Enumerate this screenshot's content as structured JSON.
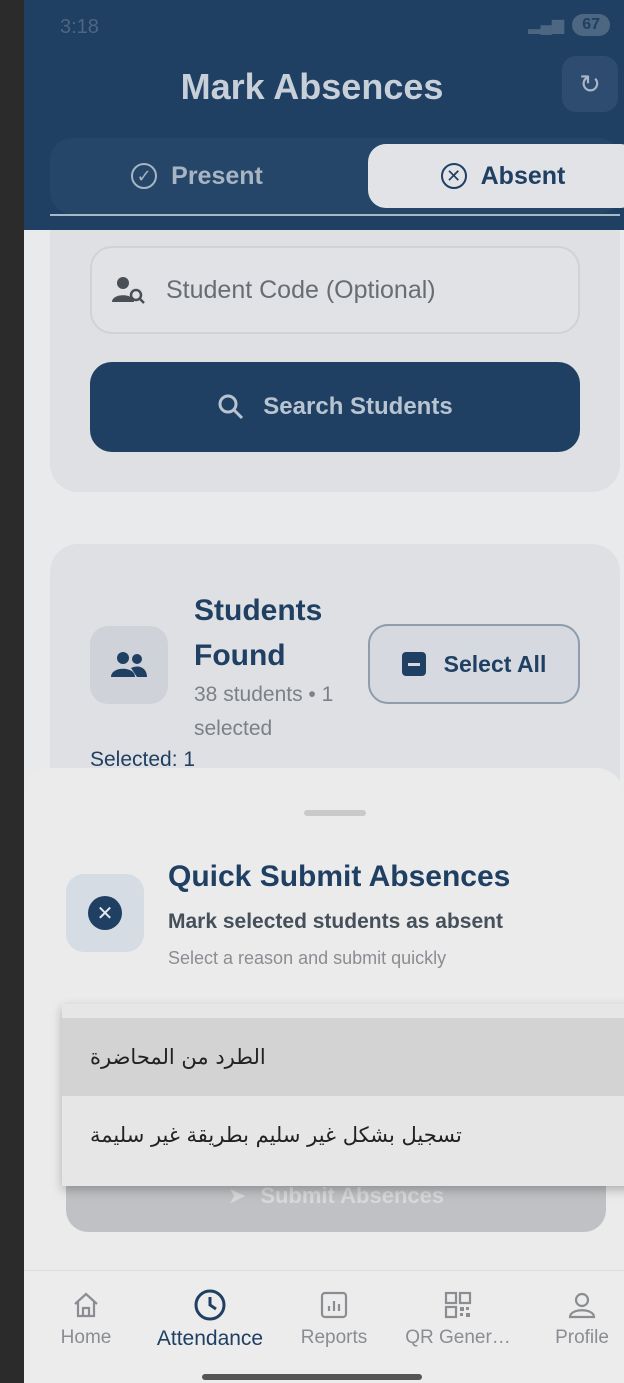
{
  "status_bar": {
    "time": "3:18",
    "battery": "67"
  },
  "header": {
    "title": "Mark Absences",
    "refresh_icon": "refresh-icon"
  },
  "tabs": [
    {
      "label": "Present",
      "icon": "check-circle-icon"
    },
    {
      "label": "Absent",
      "icon": "x-circle-icon",
      "active": true
    }
  ],
  "search": {
    "placeholder": "Student Code (Optional)",
    "button_label": "Search Students"
  },
  "students": {
    "title": "Students Found",
    "summary": "38 students • 1 selected",
    "select_all_label": "Select All",
    "selected_text": "Selected: 1"
  },
  "sheet": {
    "title": "Quick Submit Absences",
    "subtitle": "Mark selected students as absent",
    "hint": "Select a reason and submit quickly",
    "submit_label": "Submit Absences"
  },
  "reasons": [
    {
      "label": "الطرد من المحاضرة"
    },
    {
      "label": "تسجيل بشكل غير سليم بطريقة غير سليمة"
    }
  ],
  "nav": [
    {
      "label": "Home",
      "icon": "home-icon"
    },
    {
      "label": "Attendance",
      "icon": "clock-icon",
      "active": true
    },
    {
      "label": "Reports",
      "icon": "chart-icon"
    },
    {
      "label": "QR Gener…",
      "icon": "qr-icon"
    },
    {
      "label": "Profile",
      "icon": "person-icon"
    }
  ],
  "colors": {
    "primary": "#1f3f63",
    "background": "#e9eaec"
  }
}
